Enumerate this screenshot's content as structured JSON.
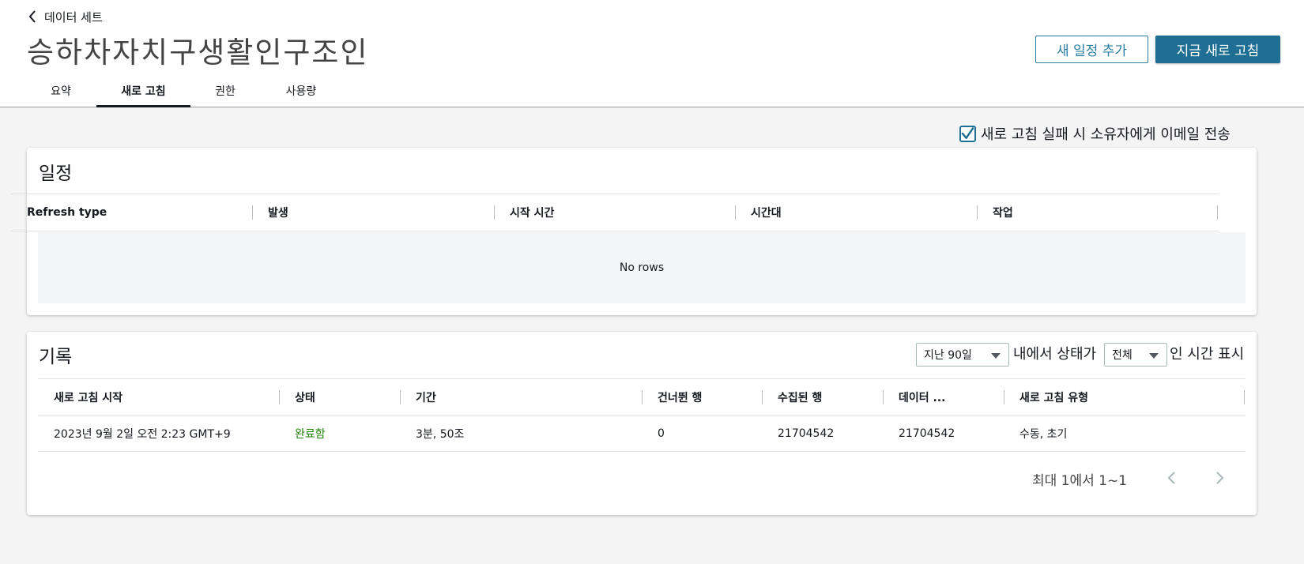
{
  "breadcrumb": {
    "back_label": "데이터 세트"
  },
  "page": {
    "title": "승하차자치구생활인구조인"
  },
  "actions": {
    "add_schedule": "새 일정 추가",
    "refresh_now": "지금 새로 고침"
  },
  "tabs": [
    {
      "label": "요약",
      "active": false
    },
    {
      "label": "새로 고침",
      "active": true
    },
    {
      "label": "권한",
      "active": false
    },
    {
      "label": "사용량",
      "active": false
    }
  ],
  "email_option": {
    "label": "새로 고침 실패 시 소유자에게 이메일 전송",
    "checked": true
  },
  "schedule": {
    "title": "일정",
    "columns": [
      "Refresh type",
      "발생",
      "시작 시간",
      "시간대",
      "작업"
    ],
    "empty_text": "No rows"
  },
  "history": {
    "title": "기록",
    "filter": {
      "period": "지난 90일",
      "text_mid": "내에서 상태가",
      "status": "전체",
      "text_end": "인 시간 표시"
    },
    "columns": [
      "새로 고침 시작",
      "상태",
      "기간",
      "건너뛴 행",
      "수집된 행",
      "데이터 ...",
      "새로 고침 유형"
    ],
    "rows": [
      [
        "2023년 9월 2일 오전 2:23 GMT+9",
        "완료함",
        "3분, 50조",
        "0",
        "21704542",
        "21704542",
        "수동, 초기"
      ]
    ],
    "pagination": "최대 1에서 1~1"
  },
  "colors": {
    "primary": "#1f6e93",
    "success": "#1d8102",
    "background": "#f4f4f4"
  },
  "icons": [
    "chevron-left-icon",
    "checkmark-icon",
    "caret-down-icon",
    "chevron-right-icon"
  ]
}
